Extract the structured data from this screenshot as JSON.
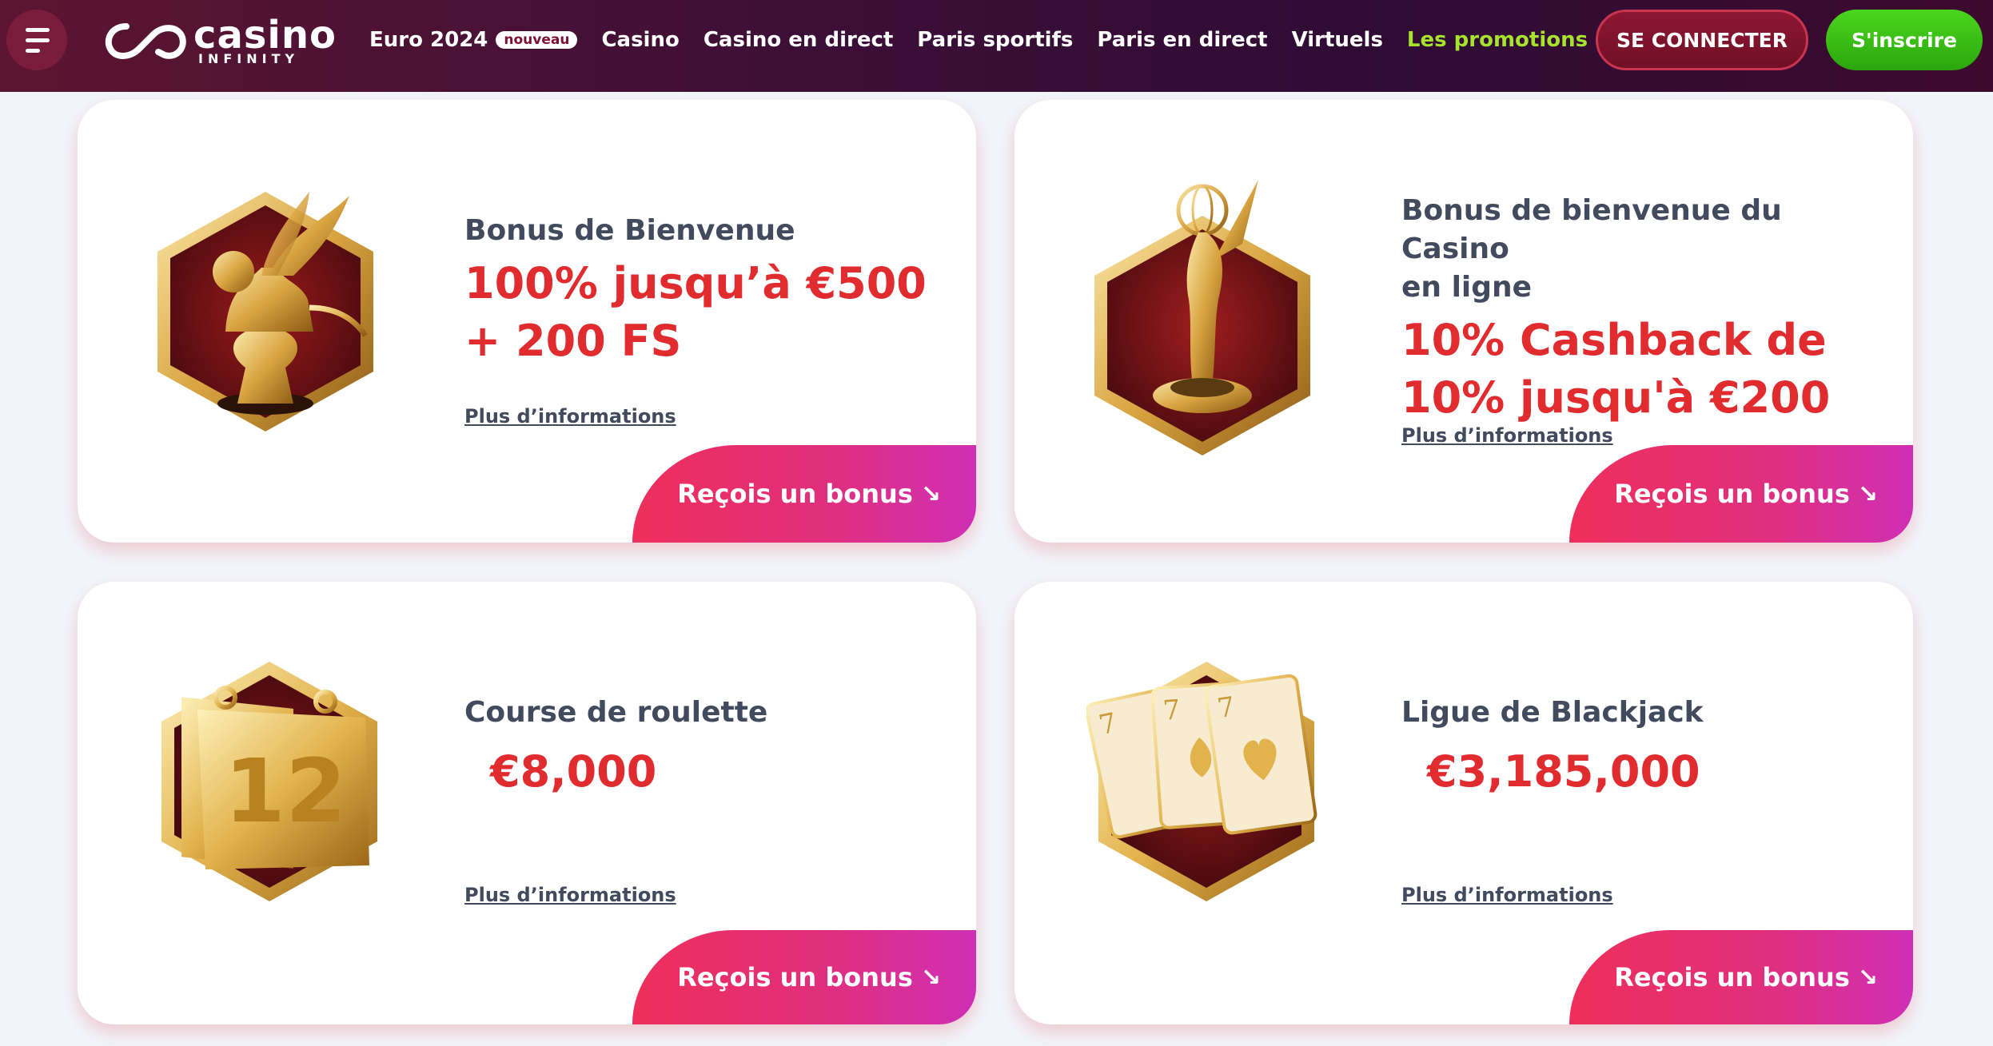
{
  "header": {
    "logo": {
      "main": "casino",
      "sub": "INFINITY"
    },
    "nav": [
      {
        "label": "Euro 2024",
        "badge": "nouveau"
      },
      {
        "label": "Casino"
      },
      {
        "label": "Casino en direct"
      },
      {
        "label": "Paris sportifs"
      },
      {
        "label": "Paris en direct"
      },
      {
        "label": "Virtuels"
      },
      {
        "label": "Les promotions"
      }
    ],
    "login_label": "SE CONNECTER",
    "signup_label": "S'inscrire"
  },
  "colors": {
    "accent_green": "#a6e22e",
    "amount_red": "#e02b2f",
    "cta_gradient_start": "#ee2f5b",
    "cta_gradient_end": "#cf2fb5"
  },
  "cards": [
    {
      "icon": "golden-winged-lion-icon",
      "title": "Bonus de Bienvenue",
      "amount_line1": "100% jusqu’à €500",
      "amount_line2": "+ 200 FS",
      "link": "Plus d’informations",
      "cta": "Reçois un bonus",
      "cta_arrow": "↘"
    },
    {
      "icon": "golden-trophy-statue-icon",
      "title_line1": "Bonus de bienvenue du Casino",
      "title_line2": "en ligne",
      "amount_line1": "10% Cashback de",
      "amount_line2": "10% jusqu'à €200",
      "link": "Plus d’informations",
      "cta": "Reçois un bonus",
      "cta_arrow": "↘"
    },
    {
      "icon": "golden-calendar-icon",
      "calendar_number": "12",
      "title": "Course de roulette",
      "amount": "€8,000",
      "link": "Plus d’informations",
      "cta": "Reçois un bonus",
      "cta_arrow": "↘"
    },
    {
      "icon": "playing-cards-sevens-icon",
      "card_rank": "7",
      "title": "Ligue de Blackjack",
      "amount": "€3,185,000",
      "link": "Plus d’informations",
      "cta": "Reçois un bonus",
      "cta_arrow": "↘"
    }
  ]
}
